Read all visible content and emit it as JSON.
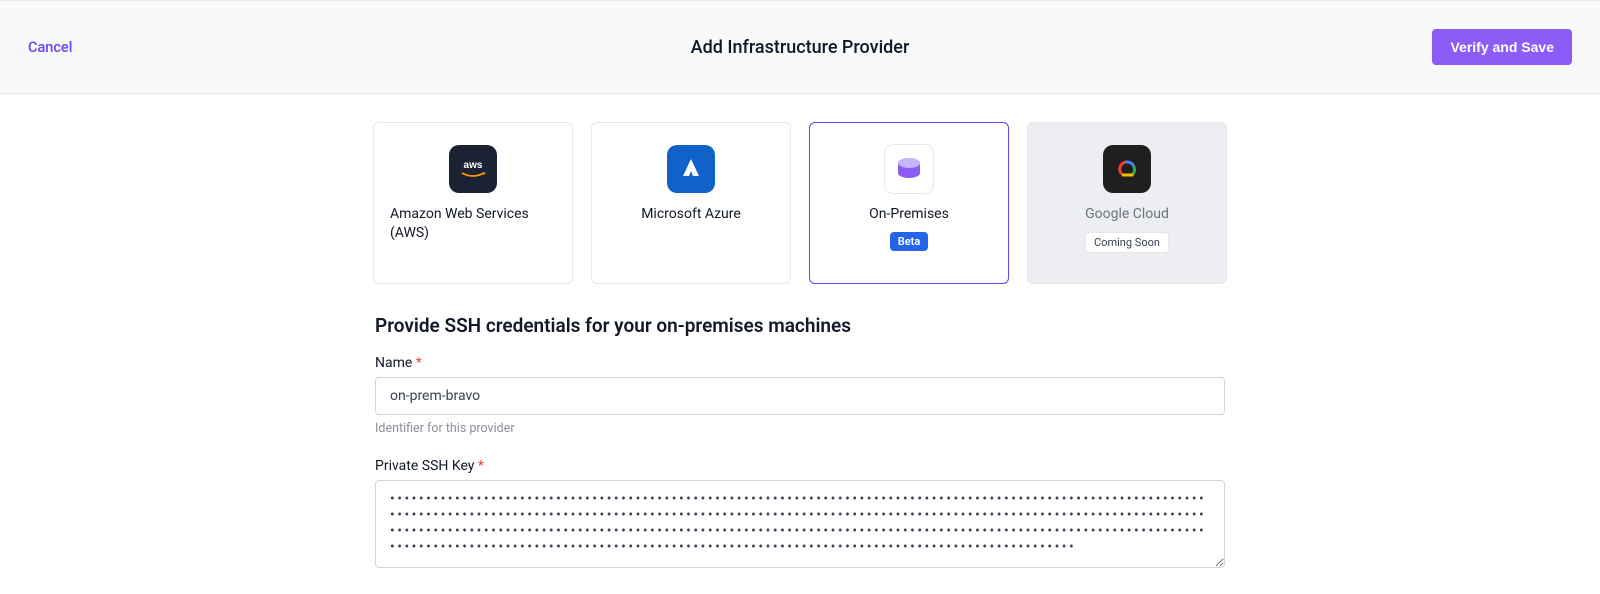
{
  "header": {
    "cancel_label": "Cancel",
    "title": "Add Infrastructure Provider",
    "save_label": "Verify and Save"
  },
  "providers": [
    {
      "label": "Amazon Web Services (AWS)",
      "badge": null
    },
    {
      "label": "Microsoft Azure",
      "badge": null
    },
    {
      "label": "On-Premises",
      "badge": "Beta"
    },
    {
      "label": "Google Cloud",
      "badge": "Coming Soon"
    }
  ],
  "form": {
    "section_heading": "Provide SSH credentials for your on-premises machines",
    "name": {
      "label": "Name",
      "required": "*",
      "value": "on-prem-bravo",
      "help": "Identifier for this provider"
    },
    "ssh_key": {
      "label": "Private SSH Key",
      "required": "*",
      "value": "••••••••••••••••••••••••••••••••••••••••••••••••••••••••••••••••••••••••••••••••••••••••••••••••••••••••••••••••••••••••••••••••••••••••••••••••••••••••••••••••••••••••••••••••••••••••••••••••••••••••••••••••••••••••••••••••••••••••••••••••••••••••••••••••••••••••••••••••••••••••••••••••••••••••••••••••••••••••••••••••••••••••••••••••••••••••••••••••••••••••••••••••••••••••••••••••••••••••••••••••••••••••••••••••••••••••••••••••••"
    }
  }
}
